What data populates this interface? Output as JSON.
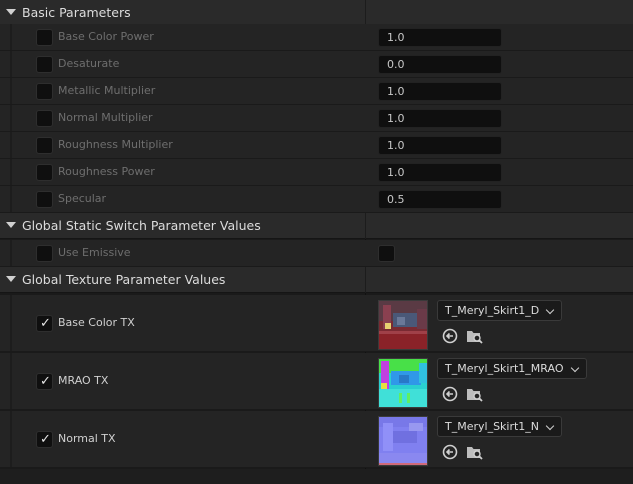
{
  "sections": {
    "basic": {
      "title": "Basic Parameters"
    },
    "static_switch": {
      "title": "Global Static Switch Parameter Values"
    },
    "texture": {
      "title": "Global Texture Parameter Values"
    }
  },
  "scalar_params": [
    {
      "label": "Base Color Power",
      "value": "1.0"
    },
    {
      "label": "Desaturate",
      "value": "0.0"
    },
    {
      "label": "Metallic Multiplier",
      "value": "1.0"
    },
    {
      "label": "Normal Multiplier",
      "value": "1.0"
    },
    {
      "label": "Roughness Multiplier",
      "value": "1.0"
    },
    {
      "label": "Roughness Power",
      "value": "1.0"
    },
    {
      "label": "Specular",
      "value": "0.5"
    }
  ],
  "switch_params": [
    {
      "label": "Use Emissive",
      "checked": false
    }
  ],
  "texture_params": [
    {
      "label": "Base Color TX",
      "texture": "T_Meryl_Skirt1_D",
      "checked": true
    },
    {
      "label": "MRAO TX",
      "texture": "T_Meryl_Skirt1_MRAO",
      "checked": true
    },
    {
      "label": "Normal TX",
      "texture": "T_Meryl_Skirt1_N",
      "checked": true
    }
  ],
  "icons": {
    "collapse": "chevron-down-icon",
    "use_selected": "arrow-left-circle-icon",
    "browse": "folder-search-icon",
    "dropdown": "chevron-down-icon",
    "check": "checkmark-icon"
  },
  "colors": {
    "section_header": "#2a2a2a",
    "row_bg": "#242424",
    "disabled_text": "#6e6e6e",
    "enabled_text": "#d0d0d0",
    "field_bg": "#0f0f0f"
  }
}
